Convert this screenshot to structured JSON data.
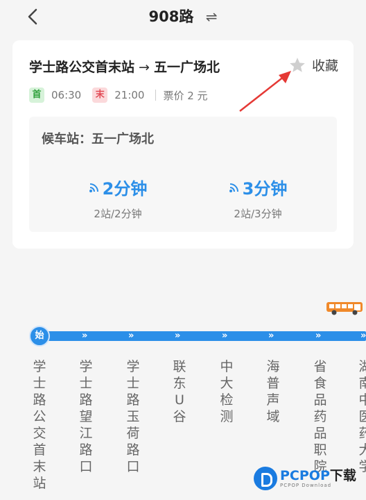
{
  "header": {
    "title": "908路",
    "swap_icon": "⇌"
  },
  "route": {
    "from": "学士路公交首末站",
    "arrow": "→",
    "to": "五一广场北",
    "favorite_label": "收藏"
  },
  "schedule": {
    "first_badge": "首",
    "first_time": "06:30",
    "last_badge": "末",
    "last_time": "21:00",
    "fare": "票价 2 元"
  },
  "waiting": {
    "title": "候车站：五一广场北",
    "arrivals": [
      {
        "time": "2分钟",
        "detail": "2站/2分钟"
      },
      {
        "time": "3分钟",
        "detail": "2站/3分钟"
      }
    ]
  },
  "line_map": {
    "start_label": "始",
    "stations": [
      "学士路公交首末站",
      "学士路望江路口",
      "学士路玉荷路口",
      "联东U谷",
      "中大检测",
      "海普声域",
      "省食品药品职院",
      "湖南中医药大学"
    ]
  },
  "watermark": {
    "brand": "PCPOP",
    "brand_suffix": "下载",
    "sub": "PCPOP Download"
  },
  "colors": {
    "accent": "#2c8fe8",
    "first_green": "#2fa13c",
    "last_red": "#e24a55",
    "arrow_red": "#e53935"
  }
}
